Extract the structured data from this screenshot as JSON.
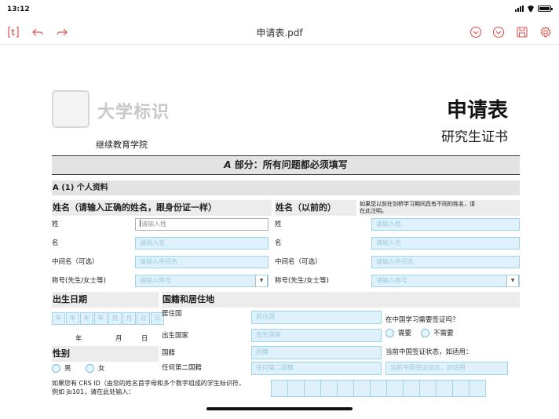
{
  "status": {
    "time": "13:12"
  },
  "toolbar": {
    "title": "申请表.pdf"
  },
  "doc": {
    "logo_text": "大学标识",
    "school": "继续教育学院",
    "title": "申请表",
    "subtitle": "研究生证书",
    "section_part": "A",
    "section_rest": " 部分：所有问题都必须填写",
    "subheading": "A (1) 个人资料",
    "name_head": "姓名（请输入正确的姓名，跟身份证一样）",
    "prev_name_head": "姓名（以前的）",
    "prev_name_note_1": "如果您以前在剑桥学习期间具有不同的姓名，请",
    "prev_name_note_2": "在此注明。",
    "left": {
      "surname_label": "姓",
      "surname_placeholder": "请输入姓",
      "given_label": "名",
      "given_placeholder": "请输入名",
      "middle_label": "中间名（可选）",
      "middle_placeholder": "请输入中间名",
      "title_label": "称号(先生/女士等)",
      "title_placeholder": "请输入称号"
    },
    "right": {
      "surname_label": "姓",
      "surname_placeholder": "请输入姓",
      "given_label": "名",
      "given_placeholder": "请输入名",
      "middle_label": "中间名（可选）",
      "middle_placeholder": "请输入中间名",
      "title_label": "称号(先生/女士等)",
      "title_placeholder": "请输入称号"
    },
    "dob_head": "出生日期",
    "dob_cells": [
      "年",
      "年",
      "年",
      "年",
      "月",
      "月",
      "日",
      "日"
    ],
    "dob_year": "年",
    "dob_month": "月",
    "dob_day": "日",
    "gender_head": "性别",
    "gender_male": "男",
    "gender_female": "女",
    "nation_head": "国籍和居住地",
    "residence_label": "居住国",
    "residence_placeholder": "居住国",
    "birth_country_label": "出生国家",
    "birth_country_placeholder": "出生国家",
    "nationality_label": "国籍",
    "nationality_placeholder": "国籍",
    "second_nationality_label": "任何第二国籍",
    "second_nationality_placeholder": "任何第二国籍",
    "visa_question": "在中国学习需要签证吗？",
    "visa_yes": "需要",
    "visa_no": "不需要",
    "visa_status_label": "当前中国签证状态，如适用：",
    "visa_status_placeholder": "当前中国签证状态，如适用",
    "crs_line1": "如果您有 CRS ID（由您的姓名首字母和多个数字组成的学生标识符，",
    "crs_line2": "例如 jb101，请在此处输入："
  },
  "icons": {
    "left_1": "text-format-icon",
    "left_2": "undo-icon",
    "left_3": "redo-icon",
    "right_1": "chevron-circle-icon",
    "right_2": "chevron-circle-icon",
    "right_3": "save-icon",
    "right_4": "settings-icon"
  },
  "colors": {
    "accent": "#d9534f",
    "field_bg": "#dff2fb",
    "field_border": "#9fd5ea"
  }
}
